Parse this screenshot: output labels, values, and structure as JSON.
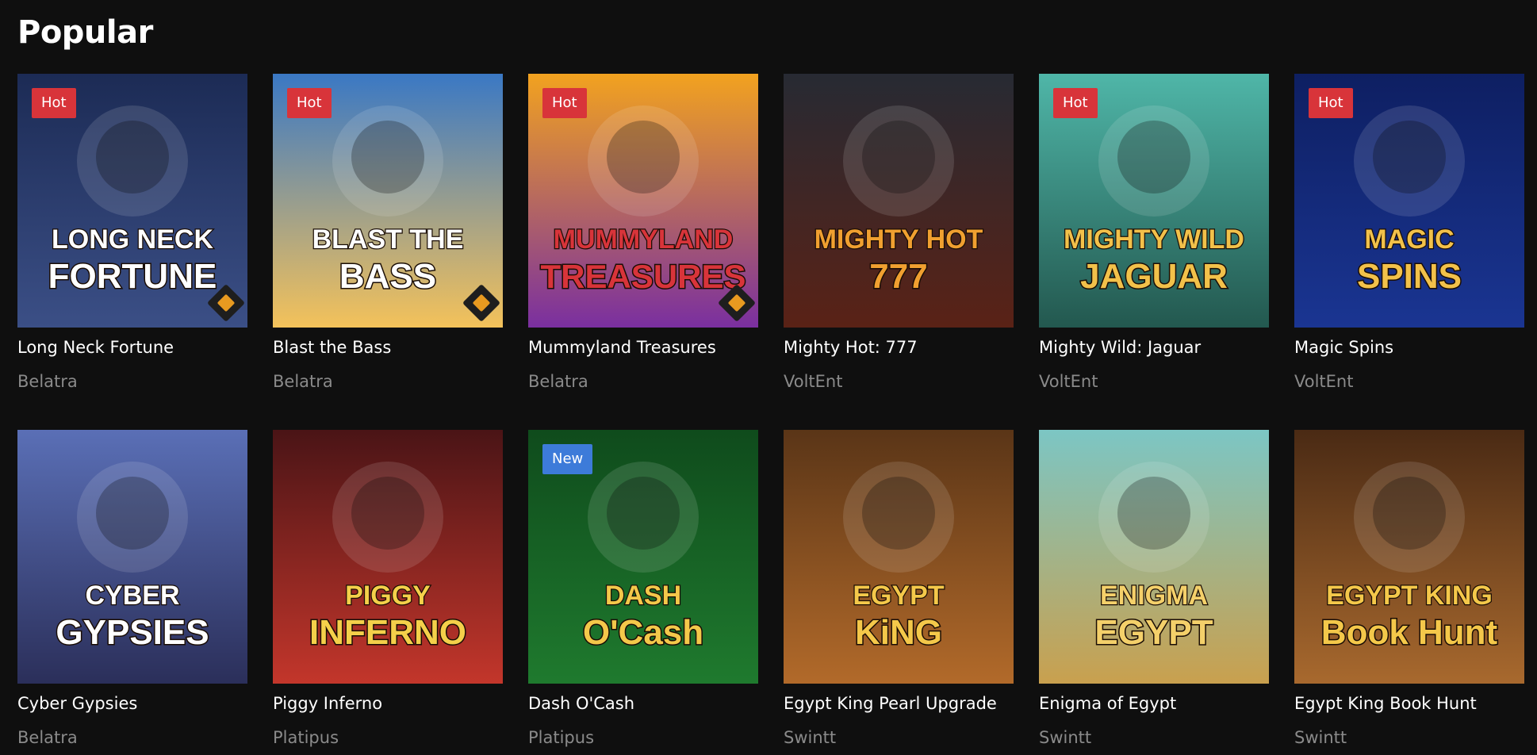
{
  "section": {
    "title": "Popular"
  },
  "games": [
    {
      "title": "Long Neck Fortune",
      "provider": "Belatra",
      "badge": "Hot",
      "art_lines": [
        "LONG NECK",
        "FORTUNE"
      ],
      "bg1": "#1c2b55",
      "bg2": "#3b4f86",
      "art_color": "#ffffff",
      "trophy": true,
      "icon": "goose-icon"
    },
    {
      "title": "Blast the Bass",
      "provider": "Belatra",
      "badge": "Hot",
      "art_lines": [
        "BLAST THE",
        "BASS"
      ],
      "bg1": "#3a78c4",
      "bg2": "#f4c25a",
      "art_color": "#ffffff",
      "trophy": true,
      "icon": "fish-icon"
    },
    {
      "title": "Mummyland Treasures",
      "provider": "Belatra",
      "badge": "Hot",
      "art_lines": [
        "MUMMYLAND",
        "TREASURES"
      ],
      "bg1": "#f2a21f",
      "bg2": "#7a2fa0",
      "art_color": "#d8343a",
      "trophy": true,
      "icon": "mummy-icon"
    },
    {
      "title": "Mighty Hot: 777",
      "provider": "VoltEnt",
      "badge": "",
      "art_lines": [
        "MIGHTY HOT",
        "777"
      ],
      "bg1": "#272a33",
      "bg2": "#5a2216",
      "art_color": "#f0a030",
      "trophy": false,
      "icon": "fire-icon"
    },
    {
      "title": "Mighty Wild: Jaguar",
      "provider": "VoltEnt",
      "badge": "Hot",
      "art_lines": [
        "MIGHTY WILD",
        "JAGUAR"
      ],
      "bg1": "#4fb6a8",
      "bg2": "#23584f",
      "art_color": "#f2c14a",
      "trophy": false,
      "icon": "jaguar-icon"
    },
    {
      "title": "Magic Spins",
      "provider": "VoltEnt",
      "badge": "Hot",
      "art_lines": [
        "MAGIC",
        "SPINS"
      ],
      "bg1": "#0e1f62",
      "bg2": "#1a3592",
      "art_color": "#f2c14a",
      "trophy": false,
      "icon": "portal-icon"
    },
    {
      "title": "Cyber Gypsies",
      "provider": "Belatra",
      "badge": "",
      "art_lines": [
        "CYBER",
        "GYPSIES"
      ],
      "bg1": "#5a6fb6",
      "bg2": "#2b2f5a",
      "art_color": "#ffffff",
      "trophy": false,
      "icon": "man-icon"
    },
    {
      "title": "Piggy Inferno",
      "provider": "Platipus",
      "badge": "",
      "art_lines": [
        "PIGGY",
        "INFERNO"
      ],
      "bg1": "#4a1416",
      "bg2": "#c3362b",
      "art_color": "#f4d04a",
      "trophy": false,
      "icon": "pig-icon"
    },
    {
      "title": "Dash O'Cash",
      "provider": "Platipus",
      "badge": "New",
      "art_lines": [
        "DASH",
        "O'Cash"
      ],
      "bg1": "#0f4b1c",
      "bg2": "#1f7a2e",
      "art_color": "#f4c84a",
      "trophy": false,
      "icon": "pot-of-gold-icon"
    },
    {
      "title": "Egypt King Pearl Upgrade",
      "provider": "Swintt",
      "badge": "",
      "art_lines": [
        "EGYPT",
        "KiNG"
      ],
      "bg1": "#5a3517",
      "bg2": "#b26a2a",
      "art_color": "#f4c84a",
      "trophy": false,
      "icon": "explorer-icon"
    },
    {
      "title": "Enigma of Egypt",
      "provider": "Swintt",
      "badge": "",
      "art_lines": [
        "ENIGMA",
        "EGYPT"
      ],
      "bg1": "#7cc6c4",
      "bg2": "#c9a04e",
      "art_color": "#f4d06a",
      "trophy": false,
      "icon": "pyramid-icon"
    },
    {
      "title": "Egypt King Book Hunt",
      "provider": "Swintt",
      "badge": "",
      "art_lines": [
        "EGYPT KING",
        "Book Hunt"
      ],
      "bg1": "#4a2a14",
      "bg2": "#a8692e",
      "art_color": "#f4c84a",
      "trophy": false,
      "icon": "book-icon"
    }
  ]
}
